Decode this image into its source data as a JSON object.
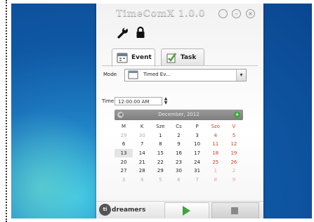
{
  "app": {
    "title": "TimeComX 1.0.0"
  },
  "tabs": [
    {
      "label": "Event",
      "active": true
    },
    {
      "label": "Task",
      "active": false
    }
  ],
  "form": {
    "mode_label": "Mode",
    "mode_value": "Timed Ev...",
    "time_label": "Time",
    "time_value": "12:00:00 AM"
  },
  "calendar": {
    "month_title": "December, 2012",
    "weekday_headers": [
      "M",
      "K",
      "Sze",
      "Cs",
      "P",
      "Szo",
      "V"
    ],
    "weeks": [
      [
        "29",
        "30",
        "1",
        "2",
        "3",
        "4",
        "5"
      ],
      [
        "6",
        "7",
        "8",
        "9",
        "10",
        "11",
        "12"
      ],
      [
        "13",
        "14",
        "15",
        "16",
        "17",
        "18",
        "19"
      ],
      [
        "20",
        "21",
        "22",
        "23",
        "24",
        "25",
        "26"
      ],
      [
        "27",
        "28",
        "29",
        "30",
        "31",
        "1",
        "2"
      ],
      [
        "3",
        "4",
        "5",
        "6",
        "7",
        "8",
        "9"
      ]
    ]
  },
  "footer": {
    "brand": "dreamers",
    "logo_text": "ti"
  },
  "colors": {
    "accent_green": "#3da53a",
    "weekend_red": "#d2402b",
    "desktop_blue": "#0f58a4"
  },
  "icons": [
    "wrench-icon",
    "lock-icon",
    "calendar-icon",
    "checklist-icon",
    "play-icon",
    "stop-icon"
  ]
}
